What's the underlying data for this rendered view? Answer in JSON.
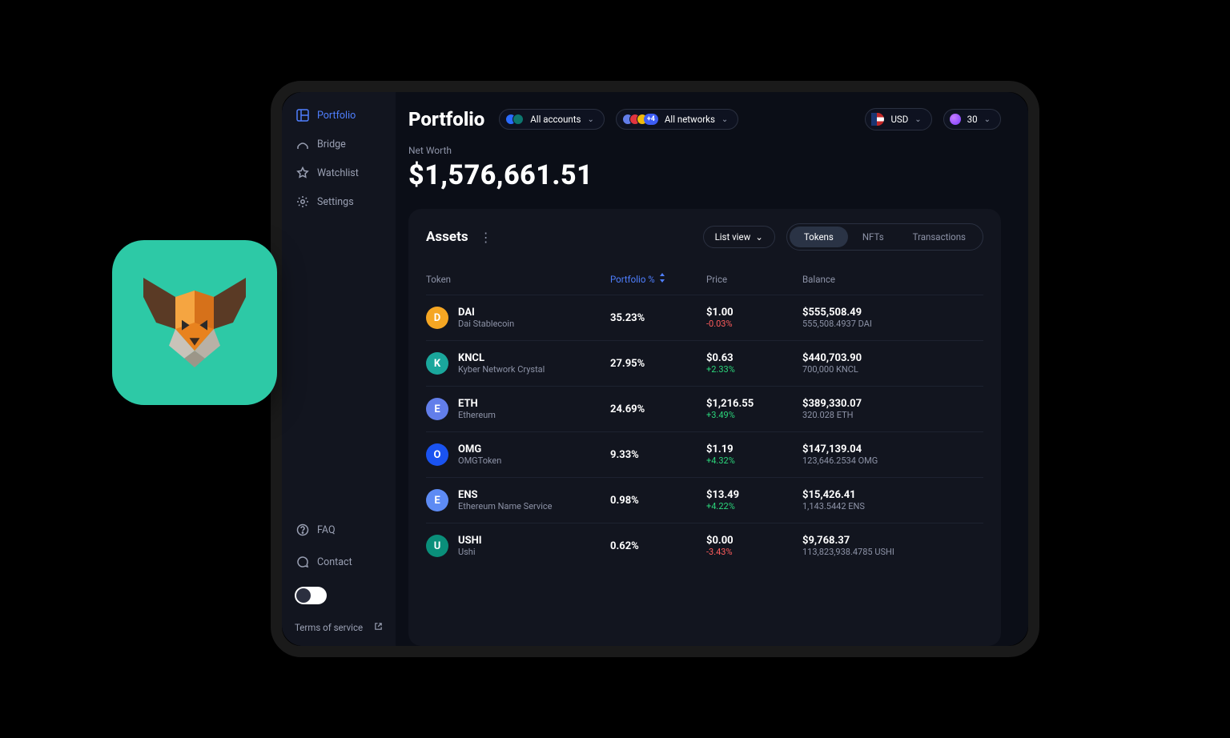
{
  "sidebar": {
    "items": [
      {
        "icon": "portfolio",
        "label": "Portfolio",
        "active": true
      },
      {
        "icon": "bridge",
        "label": "Bridge",
        "active": false
      },
      {
        "icon": "star",
        "label": "Watchlist",
        "active": false
      },
      {
        "icon": "gear",
        "label": "Settings",
        "active": false
      }
    ],
    "footer_items": [
      {
        "icon": "help",
        "label": "FAQ"
      },
      {
        "icon": "chat",
        "label": "Contact"
      }
    ],
    "terms": "Terms of service"
  },
  "header": {
    "title": "Portfolio",
    "accounts": {
      "label": "All accounts"
    },
    "networks": {
      "label": "All networks",
      "extra": "+4"
    },
    "currency": {
      "label": "USD"
    },
    "fuel": {
      "label": "30"
    }
  },
  "summary": {
    "net_worth_label": "Net Worth",
    "net_worth": "$1,576,661.51"
  },
  "assets": {
    "title": "Assets",
    "list_view": "List view",
    "tabs": [
      "Tokens",
      "NFTs",
      "Transactions"
    ],
    "active_tab": "Tokens",
    "columns": {
      "token": "Token",
      "portfolio": "Portfolio %",
      "price": "Price",
      "balance": "Balance"
    },
    "rows": [
      {
        "symbol": "DAI",
        "name": "Dai Stablecoin",
        "icon_bg": "#f5a623",
        "portfolio": "35.23%",
        "price": "$1.00",
        "change": "-0.03%",
        "change_dir": "neg",
        "bal_usd": "$555,508.49",
        "bal_token": "555,508.4937 DAI"
      },
      {
        "symbol": "KNCL",
        "name": "Kyber Network Crystal",
        "icon_bg": "#1aa79c",
        "portfolio": "27.95%",
        "price": "$0.63",
        "change": "+2.33%",
        "change_dir": "pos",
        "bal_usd": "$440,703.90",
        "bal_token": "700,000 KNCL"
      },
      {
        "symbol": "ETH",
        "name": "Ethereum",
        "icon_bg": "#627eea",
        "portfolio": "24.69%",
        "price": "$1,216.55",
        "change": "+3.49%",
        "change_dir": "pos",
        "bal_usd": "$389,330.07",
        "bal_token": "320.028 ETH"
      },
      {
        "symbol": "OMG",
        "name": "OMGToken",
        "icon_bg": "#1a53f0",
        "portfolio": "9.33%",
        "price": "$1.19",
        "change": "+4.32%",
        "change_dir": "pos",
        "bal_usd": "$147,139.04",
        "bal_token": "123,646.2534 OMG"
      },
      {
        "symbol": "ENS",
        "name": "Ethereum Name Service",
        "icon_bg": "#5d8bf4",
        "portfolio": "0.98%",
        "price": "$13.49",
        "change": "+4.22%",
        "change_dir": "pos",
        "bal_usd": "$15,426.41",
        "bal_token": "1,143.5442 ENS"
      },
      {
        "symbol": "USHI",
        "name": "Ushi",
        "icon_bg": "#0a8f7a",
        "portfolio": "0.62%",
        "price": "$0.00",
        "change": "-3.43%",
        "change_dir": "neg",
        "bal_usd": "$9,768.37",
        "bal_token": "113,823,938.4785 USHI"
      }
    ]
  }
}
